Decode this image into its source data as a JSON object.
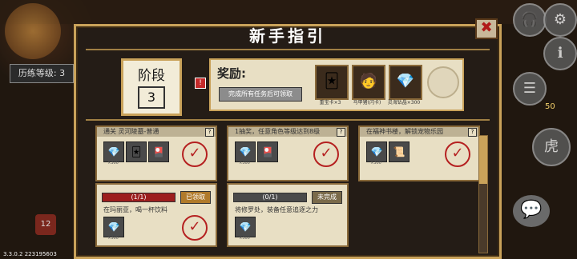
{
  "hud": {
    "exp_level": "历练等级: 3",
    "version": "3.3.0.2 223195603",
    "level_badge": "12",
    "coin": "50"
  },
  "dialog": {
    "title": "新手指引",
    "close_symbol": "✖",
    "stage": {
      "label": "阶段",
      "value": "3"
    },
    "reward": {
      "title": "奖励:",
      "claim_button": "完成所有任务后可领取",
      "items": [
        {
          "icon": "card-icon",
          "glyph": "🃏",
          "label": "重宝卡×3"
        },
        {
          "icon": "pet-icon",
          "glyph": "🧑",
          "label": "马甲猪(闪卡)"
        },
        {
          "icon": "diamond-icon",
          "glyph": "💎",
          "label": "灵海钻晶×300"
        }
      ]
    },
    "tasks": [
      {
        "title": "通关 灵河陵墓-普通",
        "rewards": [
          "💎",
          "🃏",
          "🎴"
        ],
        "caps": [
          "×300",
          "",
          ""
        ]
      },
      {
        "title": "1抽奖，任意角色等级达到8级",
        "rewards": [
          "💎",
          "🎴"
        ],
        "caps": [
          "×300",
          ""
        ]
      },
      {
        "title": "在福神书楼，解锁宠物乐园",
        "rewards": [
          "💎",
          "📜"
        ],
        "caps": [
          "×300",
          ""
        ]
      },
      {
        "title": "",
        "progress": "(1/1)",
        "status": "已领取",
        "text": "在玛丽亚，喝一杯饮料",
        "rewards": [
          "💎"
        ],
        "caps": [
          "×300"
        ]
      },
      {
        "title": "",
        "progress": "(0/1)",
        "status": "未完成",
        "text": "将修罗处，装备任意追逐之力",
        "rewards": [
          "💎"
        ],
        "caps": [
          "×300"
        ]
      }
    ]
  }
}
